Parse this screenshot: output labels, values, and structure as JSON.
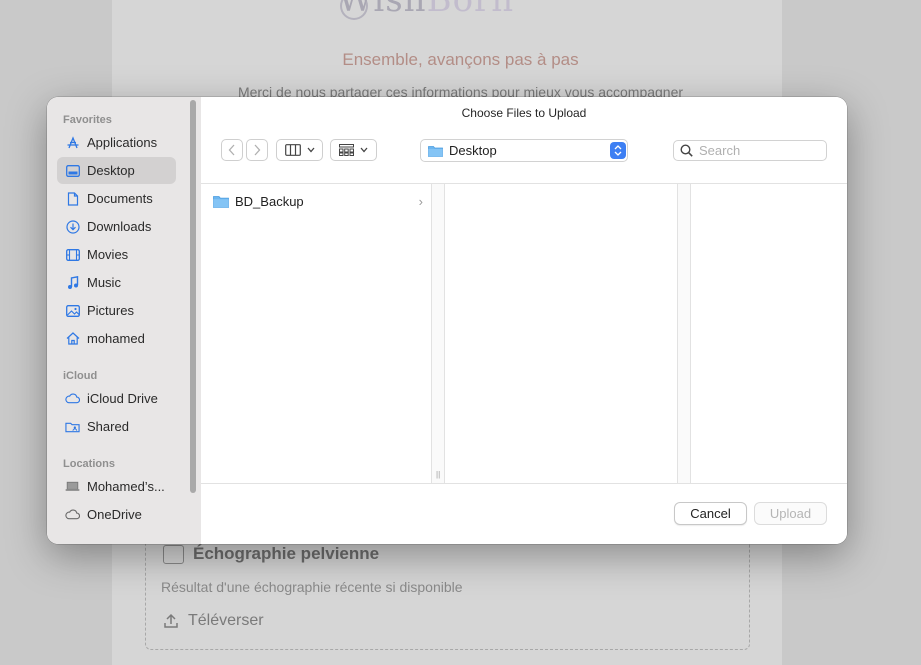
{
  "background": {
    "logo_left": "Wish",
    "logo_right": "Born",
    "tagline": "Ensemble, avançons pas à pas",
    "intro": "Merci de nous partager ces informations pour mieux vous accompagner",
    "card": {
      "title": "Échographie pelvienne",
      "description": "Résultat d'une échographie récente si disponible",
      "upload_label": "Téléverser"
    }
  },
  "dialog": {
    "title": "Choose Files to Upload",
    "sidebar": {
      "sections": [
        {
          "label": "Favorites"
        },
        {
          "label": "iCloud"
        },
        {
          "label": "Locations"
        }
      ],
      "items": [
        {
          "label": "Applications",
          "icon": "applications-icon"
        },
        {
          "label": "Desktop",
          "icon": "desktop-icon",
          "selected": true
        },
        {
          "label": "Documents",
          "icon": "document-icon"
        },
        {
          "label": "Downloads",
          "icon": "download-icon"
        },
        {
          "label": "Movies",
          "icon": "film-icon"
        },
        {
          "label": "Music",
          "icon": "music-note-icon"
        },
        {
          "label": "Pictures",
          "icon": "photo-icon"
        },
        {
          "label": "mohamed",
          "icon": "home-icon"
        },
        {
          "label": "iCloud Drive",
          "icon": "cloud-icon"
        },
        {
          "label": "Shared",
          "icon": "shared-folder-icon"
        },
        {
          "label": "Mohamed’s...",
          "icon": "laptop-icon"
        },
        {
          "label": "OneDrive",
          "icon": "cloud-icon"
        }
      ]
    },
    "toolbar": {
      "location": "Desktop",
      "search_placeholder": "Search"
    },
    "files": [
      {
        "name": "BD_Backup",
        "type": "folder"
      }
    ],
    "buttons": {
      "cancel": "Cancel",
      "upload": "Upload"
    },
    "colors": {
      "accent": "#3d7ff3",
      "folder": "#6cb6f0",
      "sidebar_icon": "#2f78e4"
    }
  }
}
